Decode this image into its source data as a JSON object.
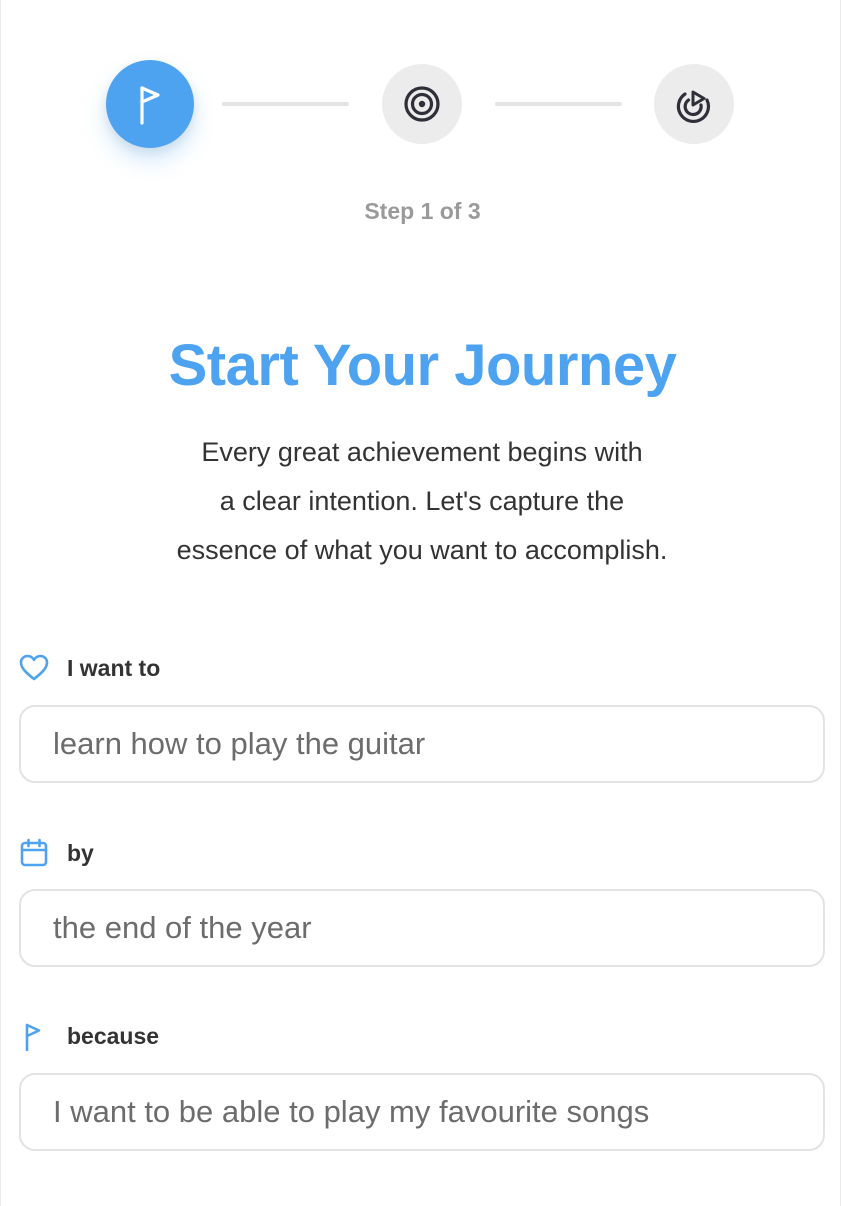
{
  "stepper": {
    "steps": [
      {
        "icon": "flag-icon",
        "active": true
      },
      {
        "icon": "target-icon",
        "active": false
      },
      {
        "icon": "progress-play-icon",
        "active": false
      }
    ],
    "caption": "Step 1 of 3",
    "colors": {
      "active": "#4ea3f0",
      "inactive": "#ececec",
      "icon_dark": "#2f2f3a"
    }
  },
  "intro": {
    "title": "Start Your Journey",
    "subtitle_lines": [
      "Every great achievement begins with",
      "a clear intention. Let's capture the",
      "essence of what you want to accomplish."
    ]
  },
  "form": {
    "goal": {
      "label": "I want to",
      "icon": "heart-icon",
      "value": "learn how to play the guitar"
    },
    "deadline": {
      "label": "by",
      "icon": "calendar-icon",
      "value": "the end of the year"
    },
    "reason": {
      "label": "because",
      "icon": "flag-icon",
      "value": "I want to be able to play my favourite songs"
    }
  }
}
